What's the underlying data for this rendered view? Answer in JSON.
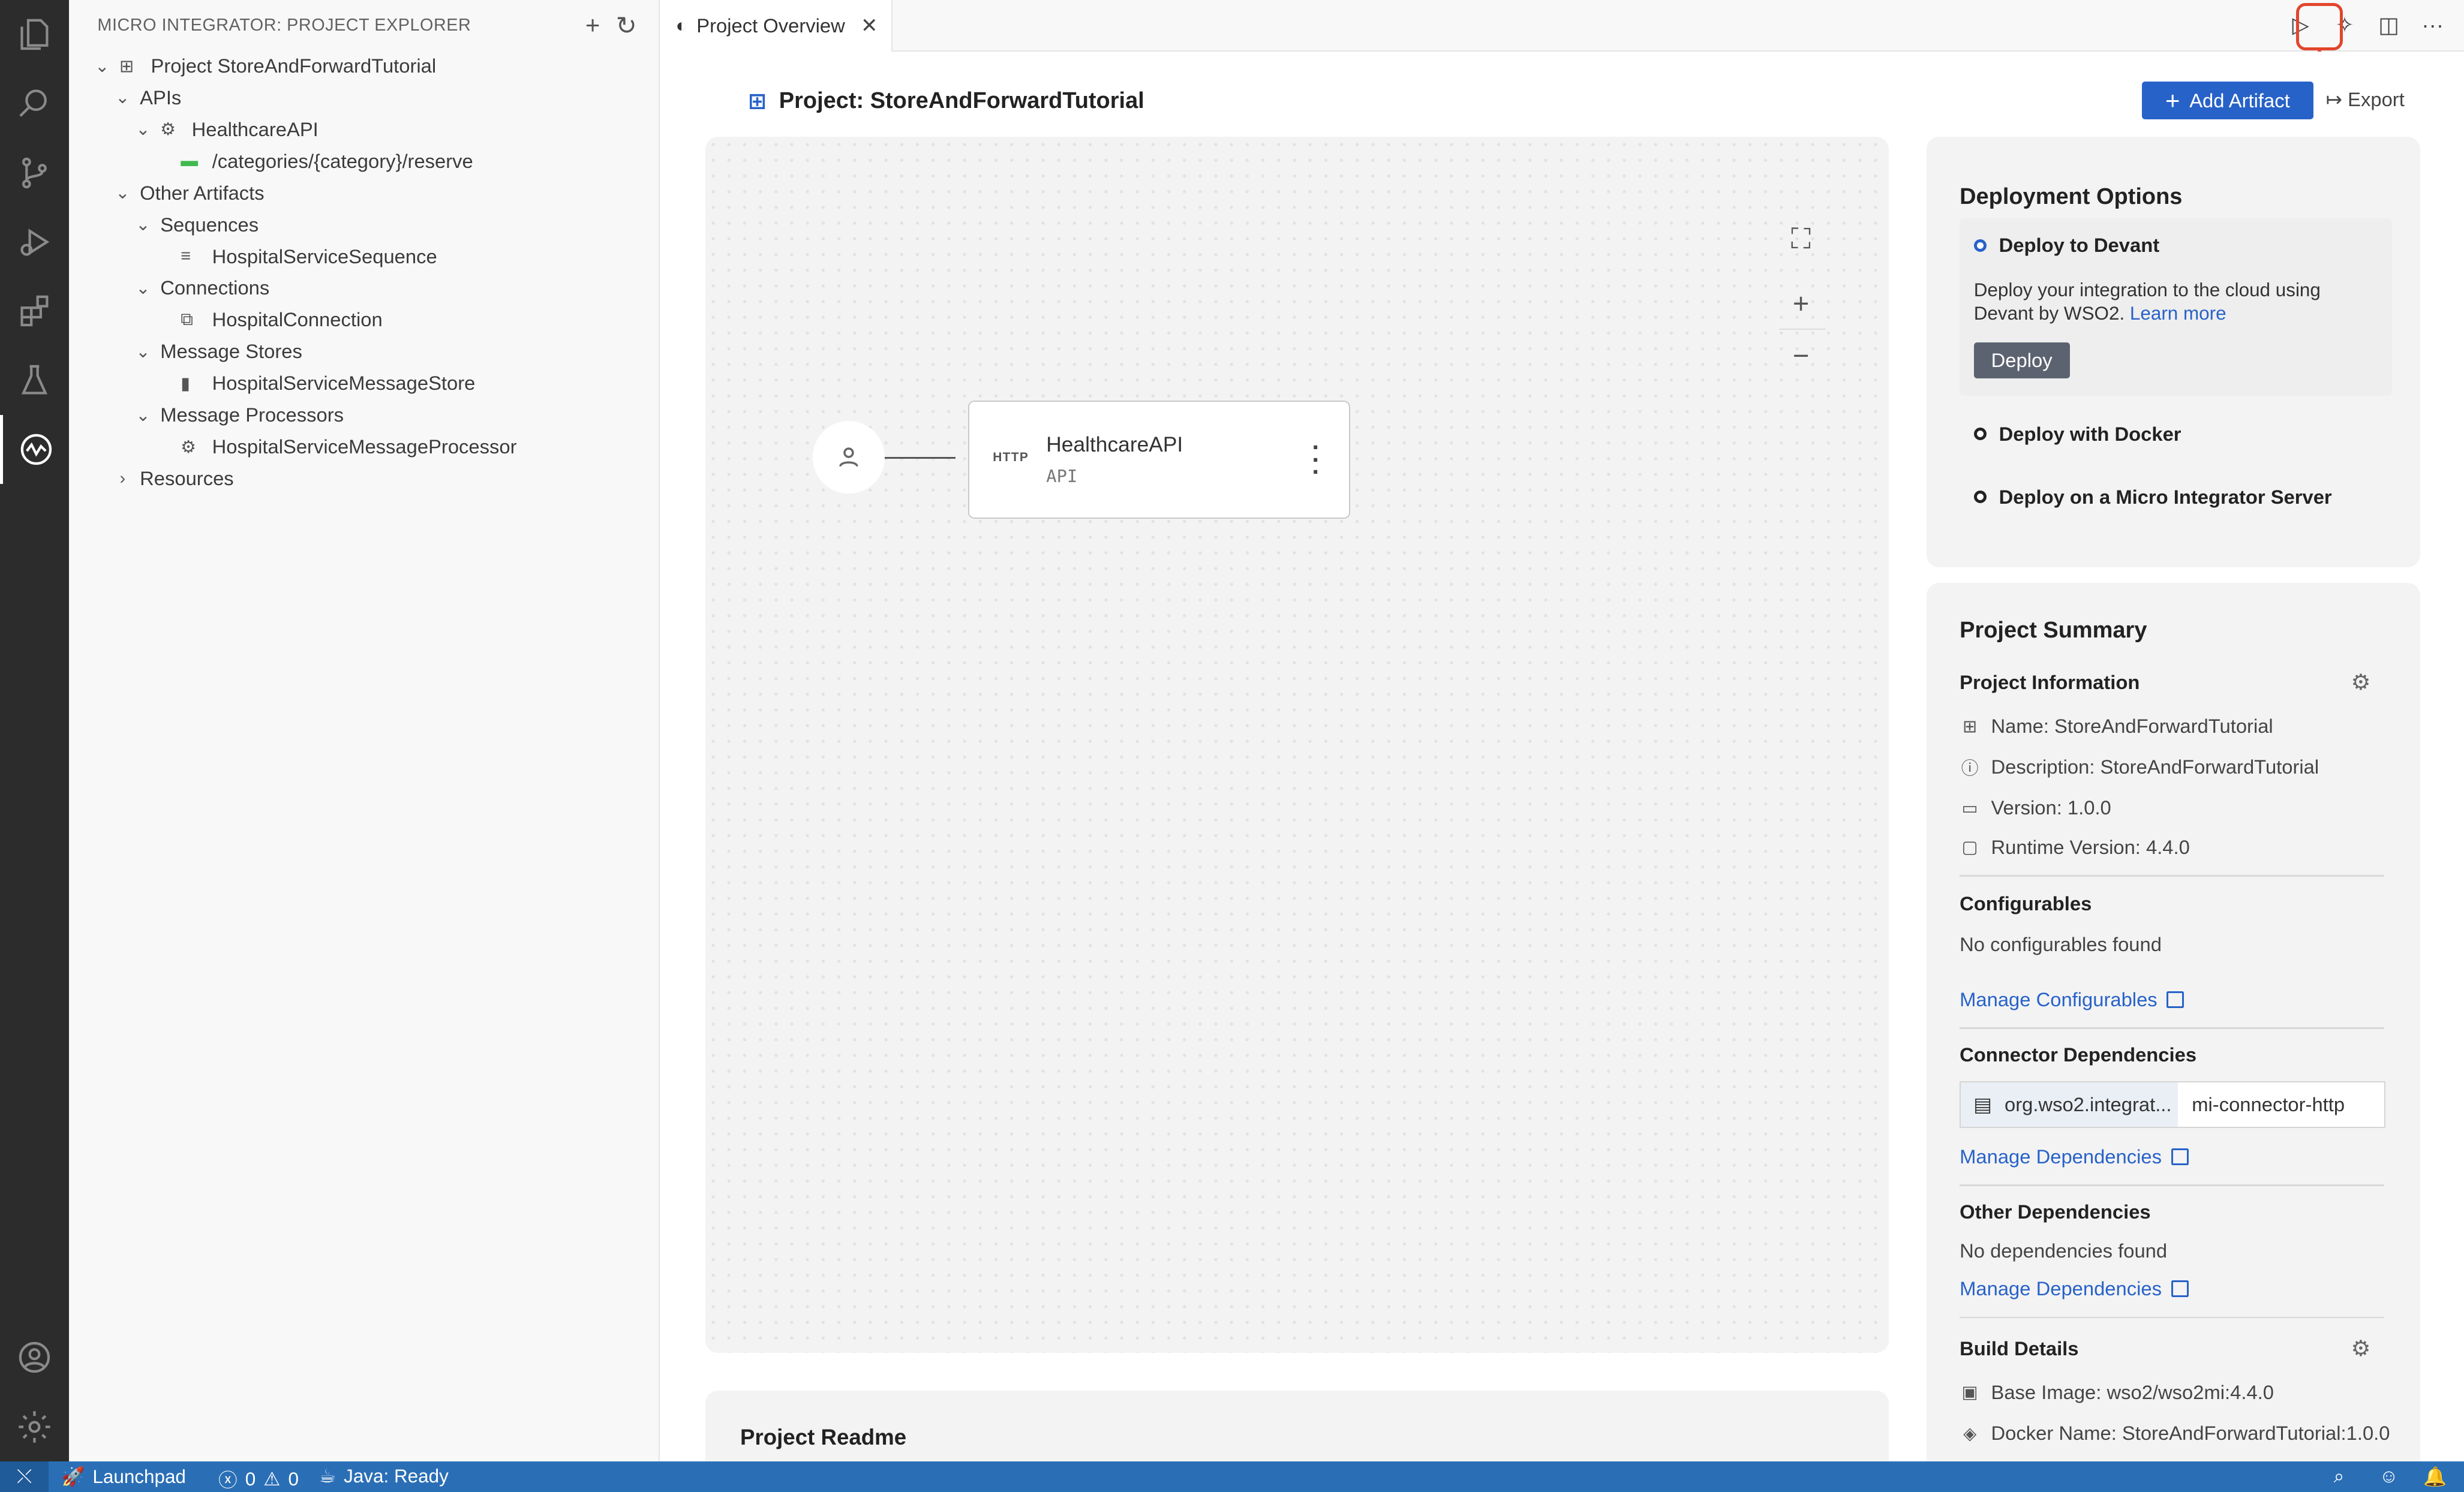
{
  "sidebar": {
    "title": "MICRO INTEGRATOR: PROJECT EXPLORER",
    "tree": [
      {
        "label": "Project StoreAndForwardTutorial",
        "indent": 0,
        "chevron": "down",
        "icon": "project"
      },
      {
        "label": "APIs",
        "indent": 1,
        "chevron": "down",
        "icon": ""
      },
      {
        "label": "HealthcareAPI",
        "indent": 2,
        "chevron": "down",
        "icon": "api"
      },
      {
        "label": "/categories/{category}/reserve",
        "indent": 3,
        "chevron": "",
        "icon": "resource"
      },
      {
        "label": "Other Artifacts",
        "indent": 1,
        "chevron": "down",
        "icon": ""
      },
      {
        "label": "Sequences",
        "indent": 2,
        "chevron": "down",
        "icon": ""
      },
      {
        "label": "HospitalServiceSequence",
        "indent": 3,
        "chevron": "",
        "icon": "sequence"
      },
      {
        "label": "Connections",
        "indent": 2,
        "chevron": "down",
        "icon": ""
      },
      {
        "label": "HospitalConnection",
        "indent": 3,
        "chevron": "",
        "icon": "connection"
      },
      {
        "label": "Message Stores",
        "indent": 2,
        "chevron": "down",
        "icon": ""
      },
      {
        "label": "HospitalServiceMessageStore",
        "indent": 3,
        "chevron": "",
        "icon": "store"
      },
      {
        "label": "Message Processors",
        "indent": 2,
        "chevron": "down",
        "icon": ""
      },
      {
        "label": "HospitalServiceMessageProcessor",
        "indent": 3,
        "chevron": "",
        "icon": "processor"
      },
      {
        "label": "Resources",
        "indent": 1,
        "chevron": "right",
        "icon": ""
      }
    ]
  },
  "tab": {
    "label": "Project Overview"
  },
  "header": {
    "title": "Project: StoreAndForwardTutorial",
    "add_label": "Add Artifact",
    "export_label": "Export"
  },
  "diagram": {
    "node_protocol": "HTTP",
    "node_name": "HealthcareAPI",
    "node_type": "API"
  },
  "deployment": {
    "title": "Deployment Options",
    "options": [
      "Deploy to Devant",
      "Deploy with Docker",
      "Deploy on a Micro Integrator Server"
    ],
    "description": "Deploy your integration to the cloud using Devant by WSO2.",
    "learn_more": "Learn more",
    "deploy_button": "Deploy"
  },
  "summary": {
    "title": "Project Summary",
    "info_heading": "Project Information",
    "name": "Name: StoreAndForwardTutorial",
    "description": "Description: StoreAndForwardTutorial",
    "version": "Version: 1.0.0",
    "runtime": "Runtime Version: 4.4.0",
    "configurables_heading": "Configurables",
    "configurables_empty": "No configurables found",
    "manage_configurables": "Manage Configurables",
    "connector_heading": "Connector Dependencies",
    "connector_group": "org.wso2.integrat...",
    "connector_artifact": "mi-connector-http",
    "manage_dependencies": "Manage Dependencies",
    "other_heading": "Other Dependencies",
    "other_empty": "No dependencies found",
    "build_heading": "Build Details",
    "base_image": "Base Image: wso2/wso2mi:4.4.0",
    "docker_name": "Docker Name: StoreAndForwardTutorial:1.0.0"
  },
  "readme": {
    "title": "Project Readme"
  },
  "status": {
    "launchpad": "Launchpad",
    "errors": "0",
    "warnings": "0",
    "java": "Java: Ready"
  },
  "colors": {
    "accent": "#2762c9",
    "status_bar": "#2a6fb6",
    "highlight": "#e2452c"
  }
}
